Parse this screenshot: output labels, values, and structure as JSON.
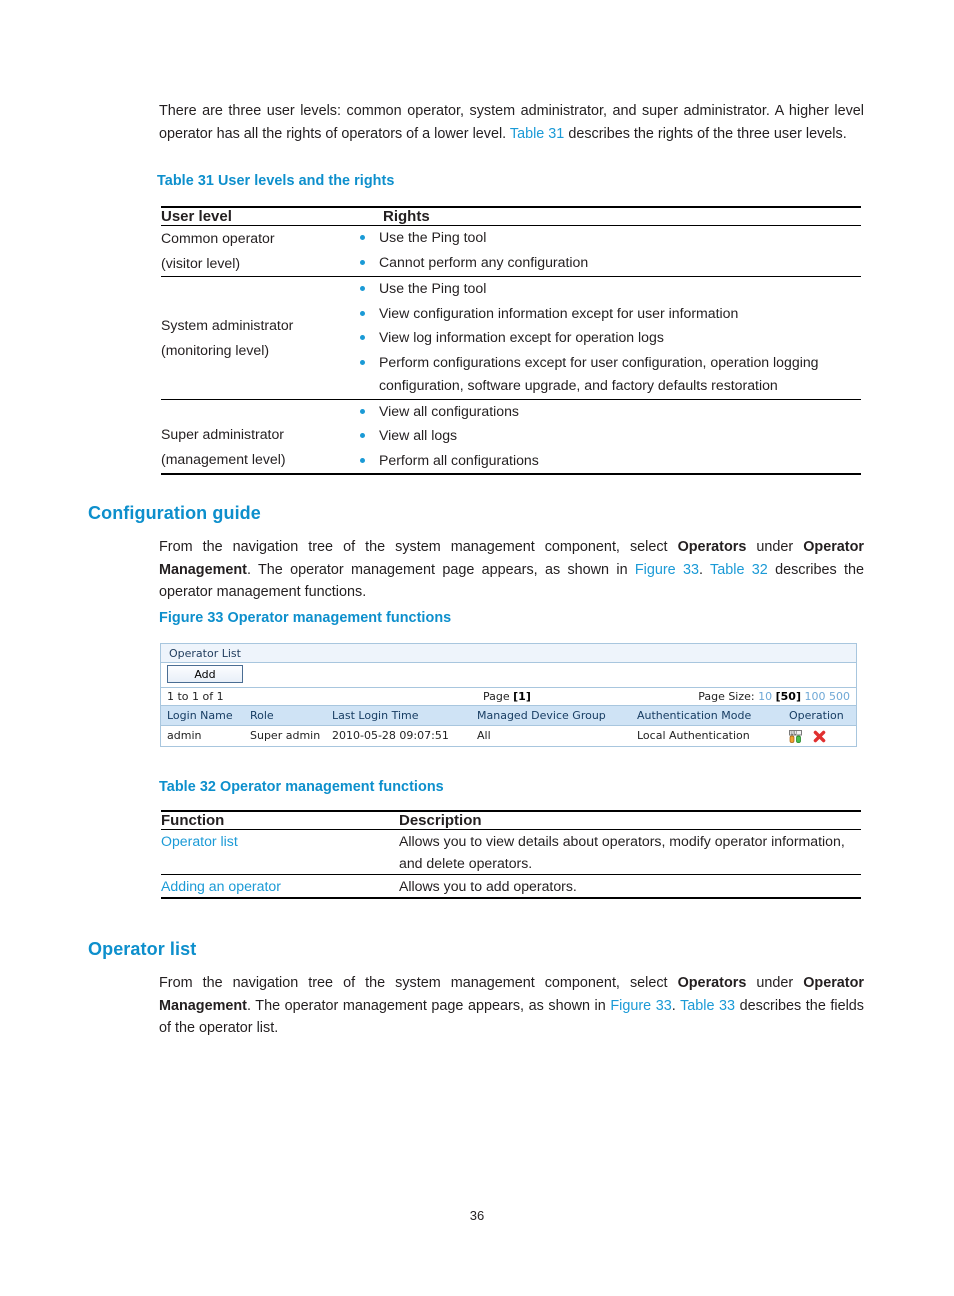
{
  "intro": {
    "line1_a": "There are three user levels: common operator, system administrator, and super administrator. A higher level operator has all the rights of operators of a lower level. ",
    "link_table31": "Table 31",
    "line1_b": " describes the rights of the three user levels."
  },
  "table31": {
    "caption": "Table 31 User levels and the rights",
    "headers": [
      "User level",
      "Rights"
    ],
    "rows": [
      {
        "level_line1": "Common operator",
        "level_line2": "(visitor level)",
        "rights": [
          "Use the Ping tool",
          "Cannot perform any configuration"
        ]
      },
      {
        "level_line1": "System administrator",
        "level_line2": "(monitoring level)",
        "rights": [
          "Use the Ping tool",
          "View configuration information except for user information",
          "View log information except for operation logs",
          "Perform configurations except for user configuration, operation logging configuration, software upgrade, and factory defaults restoration"
        ]
      },
      {
        "level_line1": "Super administrator",
        "level_line2": "(management level)",
        "rights": [
          "View all configurations",
          "View all logs",
          "Perform all configurations"
        ]
      }
    ]
  },
  "configuration_guide": {
    "heading": "Configuration guide",
    "para_a": "From the navigation tree of the system management component, select ",
    "bold_operators": "Operators",
    "para_b": " under ",
    "bold_operator_management": "Operator Management",
    "para_c": ". The operator management page appears, as shown in ",
    "link_figure33": "Figure 33",
    "para_d": ". ",
    "link_table32": "Table 32",
    "para_e": " describes the operator management functions."
  },
  "figure33": {
    "caption": "Figure 33 Operator management functions",
    "panel_title": "Operator List",
    "add_button": "Add",
    "pager": {
      "range": "1 to 1 of 1",
      "page_label": "Page ",
      "page_current": "[1]",
      "page_size_label": "Page Size: ",
      "sizes": [
        "10",
        "50",
        "100",
        "500"
      ],
      "selected_size": "50"
    },
    "grid": {
      "headers": [
        "Login Name",
        "Role",
        "Last Login Time",
        "Managed Device Group",
        "Authentication Mode",
        "Operation"
      ],
      "rows": [
        {
          "login_name": "admin",
          "role": "Super admin",
          "last_login_time": "2010-05-28 09:07:51",
          "managed_device_group": "All",
          "authentication_mode": "Local Authentication",
          "operations": [
            "modify-icon",
            "delete-icon"
          ]
        }
      ]
    }
  },
  "table32": {
    "caption": "Table 32 Operator management functions",
    "headers": [
      "Function",
      "Description"
    ],
    "rows": [
      {
        "function": "Operator list",
        "description": "Allows you to view details about operators, modify operator information, and delete operators."
      },
      {
        "function": "Adding an operator",
        "description": "Allows you to add operators."
      }
    ]
  },
  "operator_list_section": {
    "heading": "Operator list",
    "para_a": "From the navigation tree of the system management component, select ",
    "bold_operators": "Operators",
    "para_b": " under ",
    "bold_operator_management": "Operator Management",
    "para_c": ". The operator management page appears, as shown in ",
    "link_figure33": "Figure 33",
    "para_d": ". ",
    "link_table33": "Table 33",
    "para_e": " describes the fields of the operator list."
  },
  "footer": {
    "page_number": "36"
  },
  "colors": {
    "heading_blue": "#0d8fcc",
    "link_blue": "#1b9ad6",
    "bullet_blue": "#1b9ad6",
    "grid_header_bg": "#cfe3f5",
    "panel_border": "#a8c6de",
    "delete_icon_red": "#e03030"
  }
}
